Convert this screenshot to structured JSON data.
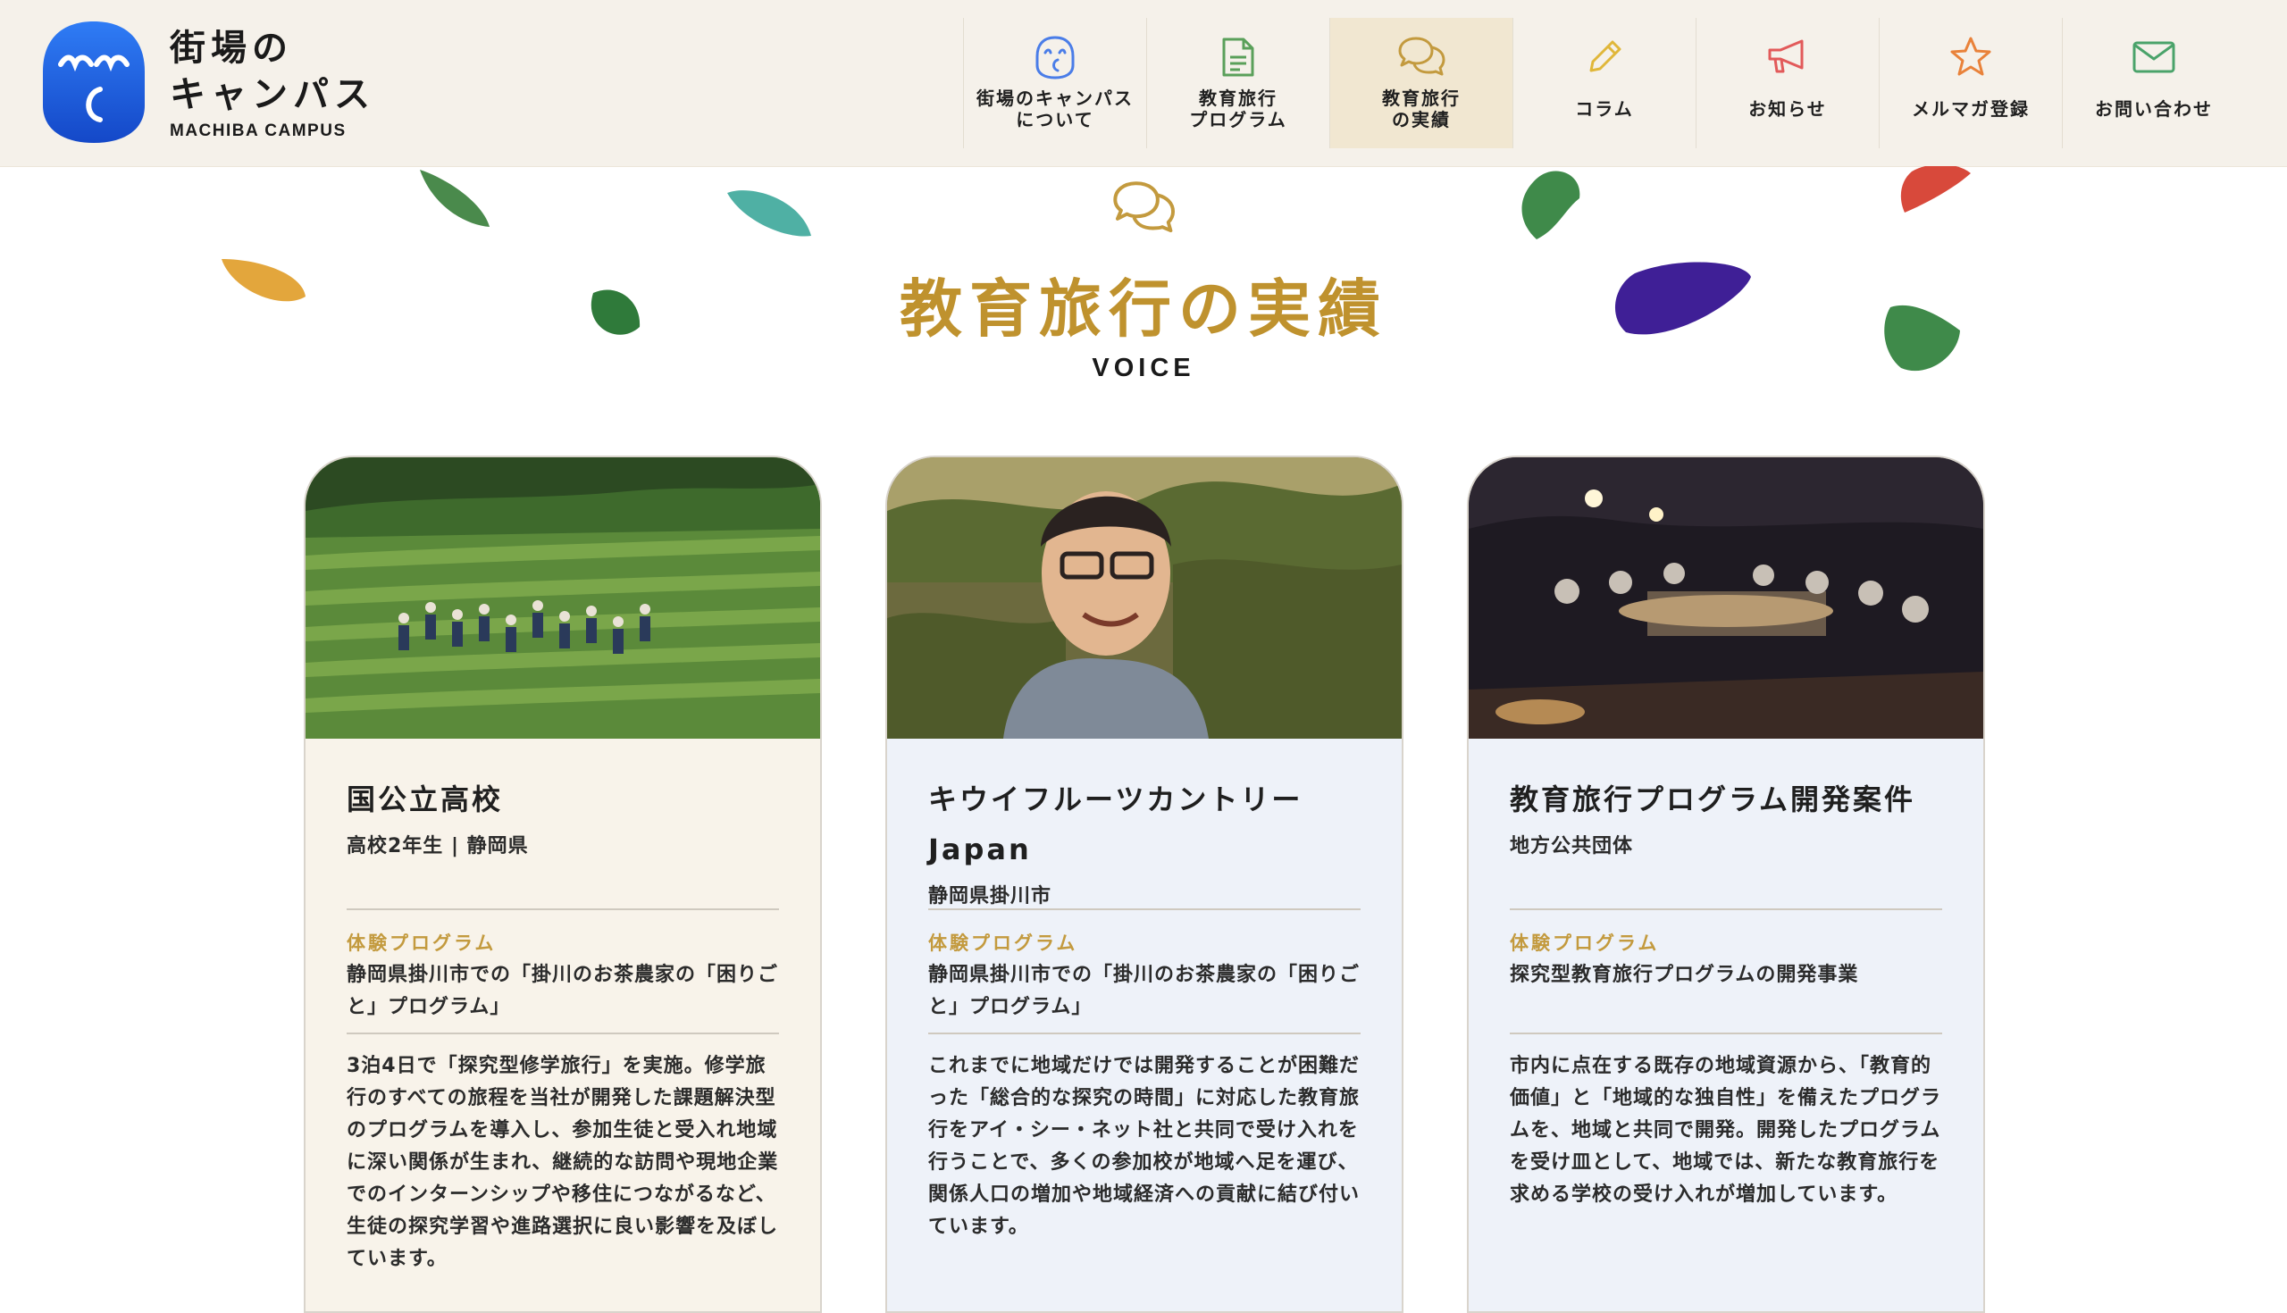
{
  "header": {
    "logo_jp_line1": "街場の",
    "logo_jp_line2": "キャンパス",
    "logo_en": "MACHIBA CAMPUS",
    "nav": [
      {
        "label": "街場のキャンパス\nについて",
        "icon": "smile-face-icon"
      },
      {
        "label": "教育旅行\nプログラム",
        "icon": "document-icon"
      },
      {
        "label": "教育旅行\nの実績",
        "icon": "speech-bubbles-icon",
        "active": true
      },
      {
        "label": "コラム",
        "icon": "pencil-icon"
      },
      {
        "label": "お知らせ",
        "icon": "megaphone-icon"
      },
      {
        "label": "メルマガ登録",
        "icon": "star-icon"
      },
      {
        "label": "お問い合わせ",
        "icon": "envelope-icon"
      }
    ]
  },
  "section": {
    "title": "教育旅行の実績",
    "subtitle": "VOICE",
    "icon": "speech-bubbles-icon"
  },
  "colors": {
    "accent_gold": "#bf922e",
    "header_bg": "#f5f1ea",
    "active_nav_bg": "#f1e7d1",
    "logo_blue": "#1e5fe0",
    "card_beige": "#f8f3ea",
    "card_blue": "#eef2f9"
  },
  "cards": [
    {
      "title": "国公立高校",
      "subtitle": "高校2年生 | 静岡県",
      "program_label": "体験プログラム",
      "program_text": "静岡県掛川市での「掛川のお茶農家の「困りごと」プログラム」",
      "description": "3泊4日で「探究型修学旅行」を実施。修学旅行のすべての旅程を当社が開発した課題解決型のプログラムを導入し、参加生徒と受入れ地域に深い関係が生まれ、継続的な訪問や現地企業でのインターンシップや移住につながるなど、生徒の探究学習や進路選択に良い影響を及ぼしています。",
      "photo": "tea-field-group-photo"
    },
    {
      "title": "キウイフルーツカントリーJapan",
      "subtitle": "静岡県掛川市",
      "program_label": "体験プログラム",
      "program_text": "静岡県掛川市での「掛川のお茶農家の「困りごと」プログラム」",
      "description": "これまでに地域だけでは開発することが困難だった「総合的な探究の時間」に対応した教育旅行をアイ・シー・ネット社と共同で受け入れを行うことで、多くの参加校が地域へ足を運び、関係人口の増加や地域経済への貢献に結び付いています。",
      "photo": "kiwi-farmer-portrait-photo"
    },
    {
      "title": "教育旅行プログラム開発案件",
      "subtitle": "地方公共団体",
      "program_label": "体験プログラム",
      "program_text": "探究型教育旅行プログラムの開発事業",
      "description": "市内に点在する既存の地域資源から、「教育的価値」と「地域的な独自性」を備えたプログラムを、地域と共同で開発。開発したプログラムを受け皿として、地域では、新たな教育旅行を求める学校の受け入れが増加しています。",
      "photo": "night-workshop-photo"
    }
  ]
}
